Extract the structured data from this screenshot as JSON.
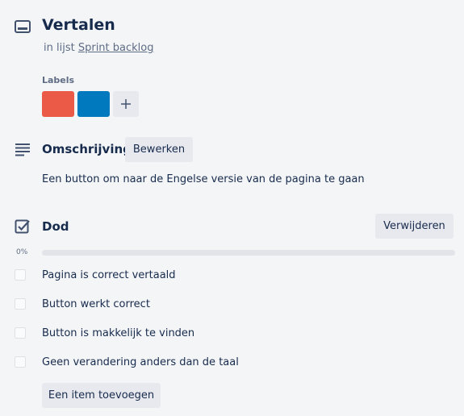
{
  "card": {
    "title": "Vertalen",
    "in_list_prefix": "in lijst",
    "list_name": "Sprint backlog"
  },
  "labels": {
    "heading": "Labels",
    "chips": [
      {
        "color": "#eb5a46",
        "icon": "label-red"
      },
      {
        "color": "#0079bf",
        "icon": "label-blue"
      }
    ],
    "add_symbol": "+"
  },
  "description": {
    "title": "Omschrijving",
    "edit_label": "Bewerken",
    "text": "Een button om naar de Engelse versie van de pagina te gaan"
  },
  "checklist": {
    "title": "Dod",
    "delete_label": "Verwijderen",
    "progress_percent": "0%",
    "progress_value": 0,
    "items": [
      {
        "label": "Pagina is correct vertaald",
        "checked": false
      },
      {
        "label": "Button werkt correct",
        "checked": false
      },
      {
        "label": "Button is makkelijk te vinden",
        "checked": false
      },
      {
        "label": "Geen verandering anders dan de taal",
        "checked": false
      }
    ],
    "add_item_label": "Een item toevoegen"
  },
  "icons": {
    "card": "card-icon",
    "description": "description-lines-icon",
    "checklist": "checklist-icon",
    "add": "plus-icon"
  }
}
